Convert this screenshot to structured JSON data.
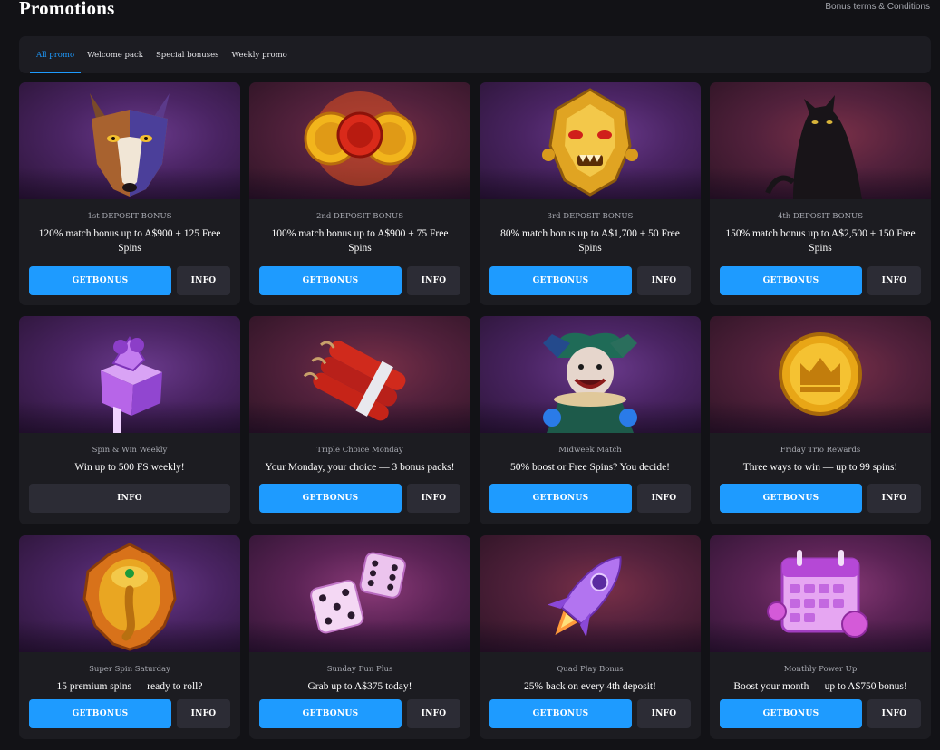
{
  "header": {
    "title": "Promotions",
    "terms_link": "Bonus terms & Conditions"
  },
  "tabs": [
    {
      "label": "All promo",
      "active": true
    },
    {
      "label": "Welcome pack",
      "active": false
    },
    {
      "label": "Special bonuses",
      "active": false
    },
    {
      "label": "Weekly promo",
      "active": false
    }
  ],
  "buttons": {
    "get_label": "GETBONUS",
    "info_label": "INFO"
  },
  "colors": {
    "accent": "#1e9bff",
    "background": "#121216",
    "card": "#1c1c21",
    "info_button": "#2c2c35"
  },
  "promos": [
    {
      "category": "1st DEPOSIT BONUS",
      "description": "120% match bonus up to A$900 + 125 Free Spins",
      "icon": "wolf-icon"
    },
    {
      "category": "2nd DEPOSIT BONUS",
      "description": "100% match bonus up to A$900 + 75 Free Spins",
      "icon": "coins-icon"
    },
    {
      "category": "3rd DEPOSIT BONUS",
      "description": "80% match bonus up to A$1,700 + 50 Free Spins",
      "icon": "golden-dragon-mask-icon"
    },
    {
      "category": "4th DEPOSIT BONUS",
      "description": "150% match bonus up to A$2,500 + 150 Free Spins",
      "icon": "black-panther-icon"
    },
    {
      "category": "Spin & Win Weekly",
      "description": "Win up to 500 FS weekly!",
      "icon": "gift-box-icon"
    },
    {
      "category": "Triple Choice Monday",
      "description": "Your Monday, your choice — 3 bonus packs!",
      "icon": "dynamite-icon"
    },
    {
      "category": "Midweek Match",
      "description": "50% boost or Free Spins? You decide!",
      "icon": "jester-icon"
    },
    {
      "category": "Friday Trio Rewards",
      "description": "Three ways to win — up to 99 spins!",
      "icon": "crown-coin-icon"
    },
    {
      "category": "Super Spin Saturday",
      "description": "15 premium spins — ready to roll?",
      "icon": "ganesha-icon"
    },
    {
      "category": "Sunday Fun Plus",
      "description": "Grab up to A$375 today!",
      "icon": "dice-icon"
    },
    {
      "category": "Quad Play Bonus",
      "description": "25% back on every 4th deposit!",
      "icon": "rocket-icon"
    },
    {
      "category": "Monthly Power Up",
      "description": "Boost your month — up to A$750 bonus!",
      "icon": "calendar-icon"
    }
  ]
}
